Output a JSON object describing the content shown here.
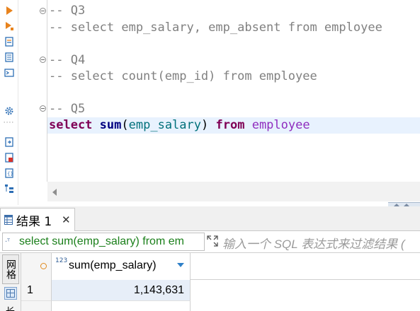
{
  "editor": {
    "lines": [
      {
        "type": "comment",
        "text": "-- Q3"
      },
      {
        "type": "comment",
        "text": "-- select emp_salary, emp_absent from employee"
      },
      {
        "type": "blank",
        "text": ""
      },
      {
        "type": "comment",
        "text": "-- Q4"
      },
      {
        "type": "comment",
        "text": "-- select count(emp_id) from employee"
      },
      {
        "type": "blank",
        "text": ""
      },
      {
        "type": "comment",
        "text": "-- Q5"
      }
    ],
    "current_line": {
      "kw_select": "select",
      "fn_sum": "sum",
      "paren_open": "(",
      "column": "emp_salary",
      "paren_close": ")",
      "kw_from": "from",
      "table": "employee"
    }
  },
  "results": {
    "tab_label": "结果 1",
    "tab_close": "✕",
    "filter_query": "select sum(emp_salary) from em",
    "filter_icon": "·ᵀ",
    "filter_placeholder": "输入一个 SQL 表达式来过滤结果 (",
    "side_tab_label": "网格",
    "side_more": "长",
    "column": {
      "type_badge": "123",
      "name": "sum(emp_salary)"
    },
    "rows": [
      {
        "num": "1",
        "value": "1,143,631"
      }
    ]
  },
  "colors": {
    "keyword": "#7f0055",
    "function": "#000080",
    "column": "#00707a",
    "table": "#8f2dbf",
    "comment": "#808080",
    "current_line_bg": "#e8f2fe",
    "filter_text": "#1a7f1a"
  },
  "icons": [
    "run-icon",
    "run-script-icon",
    "explain-icon",
    "load-plan-icon",
    "output-icon",
    "settings-icon",
    "export-icon",
    "save-icon",
    "format-icon",
    "outline-icon",
    "grid-view-icon",
    "expand-icon"
  ]
}
